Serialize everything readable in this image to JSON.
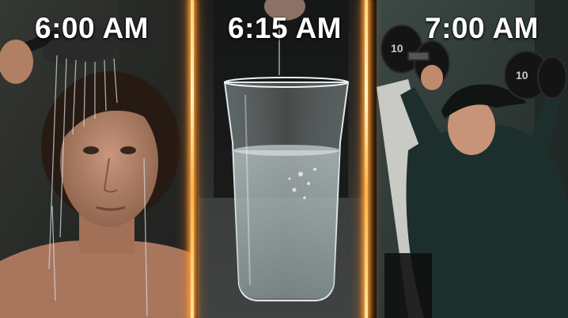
{
  "panels": [
    {
      "time_label": "6:00 AM"
    },
    {
      "time_label": "6:15 AM"
    },
    {
      "time_label": "7:00 AM"
    }
  ],
  "colors": {
    "divider_glow": "#ffb347",
    "label_text": "#ffffff"
  }
}
